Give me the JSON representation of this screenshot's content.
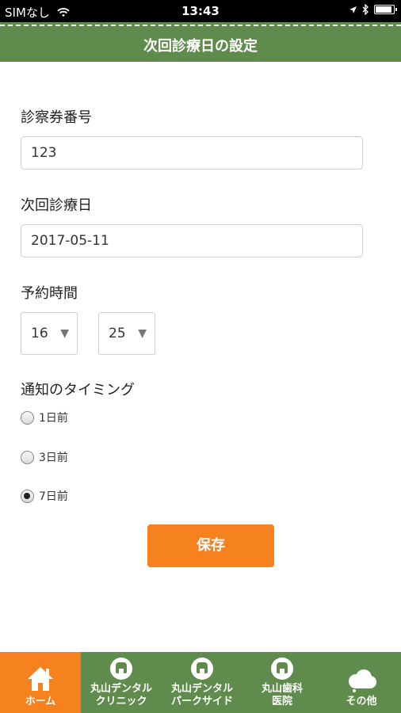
{
  "status_bar": {
    "carrier": "SIMなし",
    "time": "13:43"
  },
  "header": {
    "title": "次回診療日の設定"
  },
  "form": {
    "card_number_label": "診察券番号",
    "card_number_value": "123",
    "next_date_label": "次回診療日",
    "next_date_value": "2017-05-11",
    "time_label": "予約時間",
    "hour_value": "16",
    "minute_value": "25",
    "notify_label": "通知のタイミング",
    "notify_options": [
      {
        "label": "1日前",
        "checked": false
      },
      {
        "label": "3日前",
        "checked": false
      },
      {
        "label": "7日前",
        "checked": true
      }
    ],
    "save_label": "保存"
  },
  "tabbar": {
    "items": [
      {
        "label": "ホーム",
        "icon": "home-icon",
        "active": true
      },
      {
        "label": "丸山デンタル クリニック",
        "line1": "丸山デンタル",
        "line2": "クリニック",
        "icon": "tooth-icon"
      },
      {
        "label": "丸山デンタル パークサイド",
        "line1": "丸山デンタル",
        "line2": "パークサイド",
        "icon": "tooth-icon"
      },
      {
        "label": "丸山歯科 医院",
        "line1": "丸山歯科",
        "line2": "医院",
        "icon": "tooth-icon"
      },
      {
        "label": "その他",
        "icon": "cloud-icon"
      }
    ]
  },
  "colors": {
    "header_green": "#5f8c4c",
    "accent_orange": "#f5811f"
  }
}
